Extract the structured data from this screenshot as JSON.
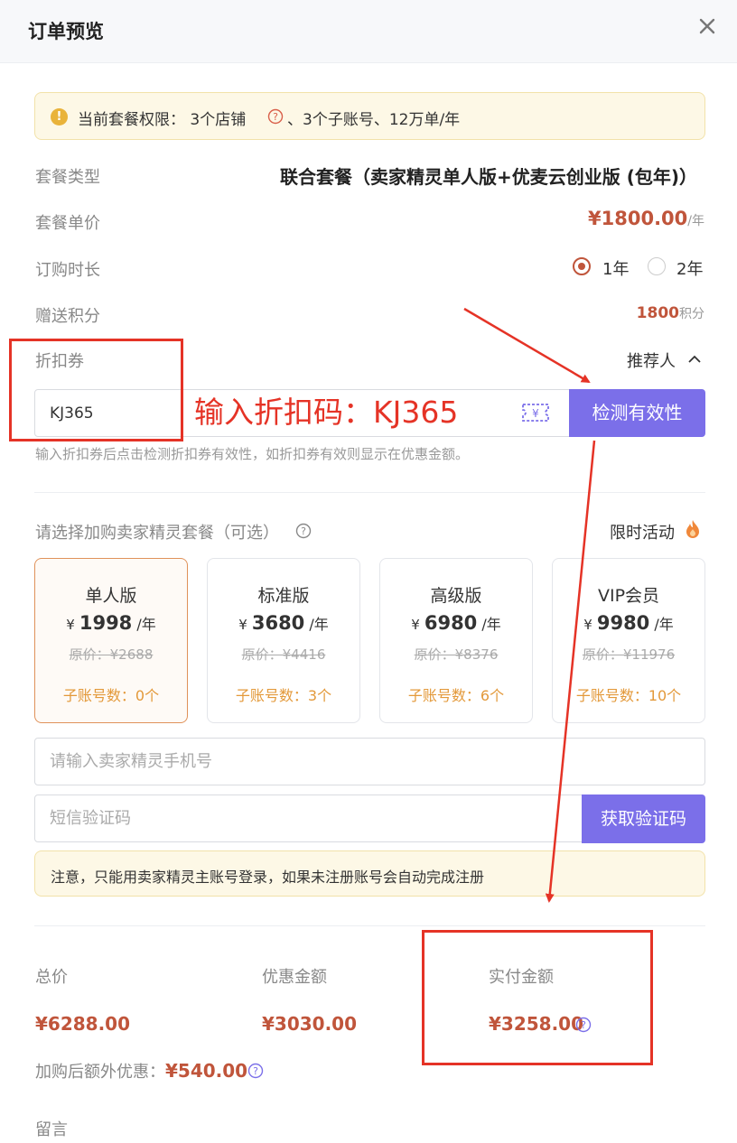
{
  "header": {
    "title": "订单预览",
    "close_icon": "close-icon"
  },
  "permission": {
    "icon": "warning-icon",
    "prefix": "当前套餐权限： 3个店铺",
    "suffix": "、3个子账号、12万单/年"
  },
  "rows": {
    "package_type": {
      "label": "套餐类型",
      "value": "联合套餐（卖家精灵单人版+优麦云创业版 (包年)）"
    },
    "unit_price": {
      "label": "套餐单价",
      "value": "¥1800.00",
      "unit": "/年"
    },
    "duration": {
      "label": "订购时长",
      "options": [
        {
          "label": "1年",
          "selected": true
        },
        {
          "label": "2年",
          "selected": false
        }
      ]
    },
    "points": {
      "label": "赠送积分",
      "value": "1800",
      "unit": "积分"
    }
  },
  "coupon": {
    "label": "折扣券",
    "referrer": "推荐人",
    "input_value": "KJ365",
    "check_button": "检测有效性",
    "hint": "输入折扣券后点击检测折扣券有效性，如折扣券有效则显示在优惠金额。"
  },
  "annotation": {
    "text": "输入折扣码：KJ365",
    "color": "#e53326"
  },
  "addon": {
    "title": "请选择加购卖家精灵套餐（可选）",
    "limited": "限时活动",
    "cards": [
      {
        "name": "单人版",
        "currency": "¥",
        "price": "1998",
        "unit": "/年",
        "original": "原价：¥2688",
        "sub": "子账号数：0个",
        "selected": true
      },
      {
        "name": "标准版",
        "currency": "¥",
        "price": "3680",
        "unit": "/年",
        "original": "原价：¥4416",
        "sub": "子账号数：3个",
        "selected": false
      },
      {
        "name": "高级版",
        "currency": "¥",
        "price": "6980",
        "unit": "/年",
        "original": "原价：¥8376",
        "sub": "子账号数：6个",
        "selected": false
      },
      {
        "name": "VIP会员",
        "currency": "¥",
        "price": "9980",
        "unit": "/年",
        "original": "原价：¥11976",
        "sub": "子账号数：10个",
        "selected": false
      }
    ],
    "phone_placeholder": "请输入卖家精灵手机号",
    "sms_placeholder": "短信验证码",
    "sms_button": "获取验证码",
    "notice": "注意，只能用卖家精灵主账号登录，如果未注册账号会自动完成注册"
  },
  "summary": {
    "total_label": "总价",
    "total_value": "¥6288.00",
    "discount_label": "优惠金额",
    "discount_value": "¥3030.00",
    "paid_label": "实付金额",
    "paid_value": "¥3258.00",
    "extra_label": "加购后额外优惠：",
    "extra_value": "¥540.00",
    "message_label": "留言"
  },
  "colors": {
    "accent": "#7b6fe9",
    "price": "#c0553b",
    "selected_border": "#e0925a",
    "subaccount": "#e3993a"
  }
}
